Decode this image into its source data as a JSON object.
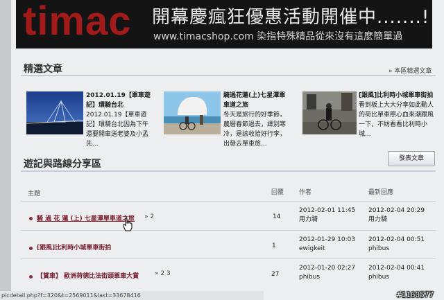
{
  "banner": {
    "logo": "timac",
    "headline": "開幕慶瘋狂優惠活動開催中.......!",
    "subline": "www.timacshop.com 染指特殊精品從來沒有這麼簡單過"
  },
  "featured": {
    "title": "精選文章",
    "more_link": "» 本區精選文章",
    "articles": [
      {
        "title": "2012.01.19【單車遊記】環騎台北",
        "excerpt": "2012.01.19【單車遊記】環騎台北因為下午還要開車送老婆及小孟先..."
      },
      {
        "title": "騎過花蓮(上)七星潭單車道之旅",
        "excerpt": "冬天是旅行的好季節，農曆春節過去，譯別寒冷，是該收拾好行李，出發去單車旅..."
      },
      {
        "title": "[跟風]比利時小城單車街拍",
        "excerpt": "看到板上大大分享如此動人的荷比單車照心血來潮跟風一下，不妨看看比利時小城..."
      }
    ]
  },
  "forum": {
    "title": "遊記與路線分享區",
    "post_button": "發表文章",
    "headers": {
      "topic": "主題",
      "replies": "回覆",
      "author": "作者",
      "latest": "最新回應"
    },
    "rows": [
      {
        "topic": "騎 過 花 蓮 (上) 七星潭單車道之旅",
        "pages": "» 2",
        "replies": "14",
        "author_date": "2012-02-01 11:45",
        "author": "用力騎",
        "latest_date": "2012-02-04 20:29",
        "latest_user": "用力騎"
      },
      {
        "topic": "[跟風]比利時小城單車街拍",
        "pages": "",
        "replies": "1",
        "author_date": "2012-01-29 10:03",
        "author": "ewigkeit",
        "latest_date": "2012-02-04 00:51",
        "latest_user": "phibus"
      },
      {
        "topic": "【賞車】 歐洲荷德比法街頭單車大賞",
        "pages": "» 2 3",
        "replies": "27",
        "author_date": "2012-01-20 02:27",
        "author": "phibus",
        "latest_date": "2012-02-04 00:41",
        "latest_user": "phibus"
      }
    ]
  },
  "status_bar": {
    "url": "picdetail.php?f=320&t=2569011&last=33678416"
  },
  "watermark": "#1160577",
  "colors": {
    "topic": "#7a1f2d",
    "logo": "#a31a1a",
    "banner_bg": "#141414"
  }
}
